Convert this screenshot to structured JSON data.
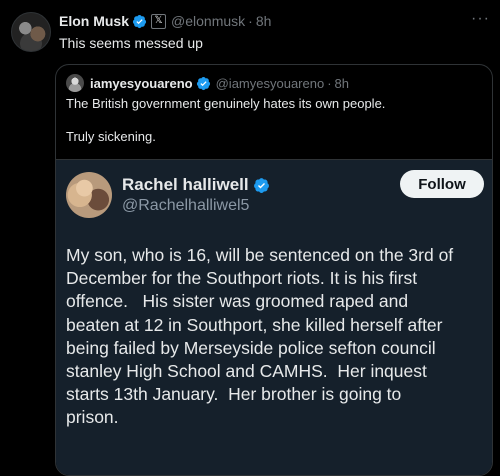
{
  "tweet": {
    "author_name": "Elon Musk",
    "handle": "@elonmusk",
    "separator": "·",
    "time": "8h",
    "affiliate_badge": "𝕏",
    "more_icon": "more-dots-icon",
    "text": "This seems messed up"
  },
  "quote": {
    "author_name": "iamyesyouareno",
    "handle": "@iamyesyouareno",
    "separator": "·",
    "time": "8h",
    "line1": "The British government genuinely hates its own people.",
    "line2": "Truly sickening."
  },
  "embedded": {
    "author_name": "Rachel halliwell",
    "handle": "@Rachelhalliwel5",
    "follow_label": "Follow",
    "lines": [
      "My son, who is 16, will be sentenced on the 3rd of",
      "December for the Southport riots. It is his first",
      "offence.   His sister was groomed raped and",
      "beaten at 12 in Southport, she killed herself after",
      "being failed by Merseyside police sefton council",
      "stanley High School and CAMHS.  Her inquest",
      "starts 13th January.  Her brother is going to",
      "prison."
    ]
  },
  "colors": {
    "background": "#000000",
    "text": "#e7e9ea",
    "muted": "#71767b",
    "verified_blue": "#1d9bf0",
    "embed_bg": "#15202b"
  }
}
